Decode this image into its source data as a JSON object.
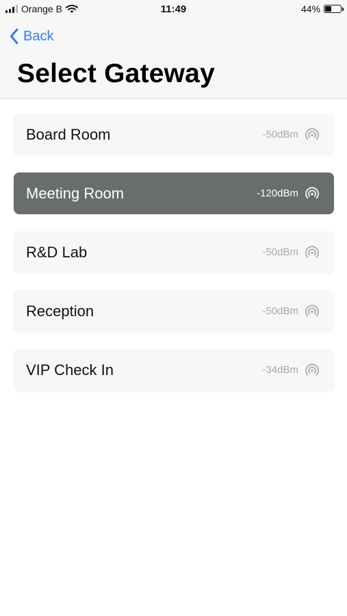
{
  "status_bar": {
    "carrier": "Orange B",
    "time": "11:49",
    "battery_percent": "44%",
    "battery_level": 0.44,
    "icons": [
      "cellular-signal-icon",
      "wifi-icon",
      "battery-icon"
    ]
  },
  "nav": {
    "back_label": "Back",
    "back_icon": "chevron-left-icon",
    "title": "Select Gateway"
  },
  "gateways": [
    {
      "name": "Board Room",
      "signal": "-50dBm",
      "icon": "broadcast-signal-icon",
      "selected": false
    },
    {
      "name": "Meeting Room",
      "signal": "-120dBm",
      "icon": "broadcast-signal-icon",
      "selected": true
    },
    {
      "name": "R&D Lab",
      "signal": "-50dBm",
      "icon": "broadcast-signal-icon",
      "selected": false
    },
    {
      "name": "Reception",
      "signal": "-50dBm",
      "icon": "broadcast-signal-icon",
      "selected": false
    },
    {
      "name": "VIP Check In",
      "signal": "-34dBm",
      "icon": "broadcast-signal-icon",
      "selected": false
    }
  ],
  "colors": {
    "accent": "#2f7cf6",
    "selected_row": "#686d6e",
    "row_background": "#f7f7f7",
    "muted_text": "#a8a8a8"
  }
}
